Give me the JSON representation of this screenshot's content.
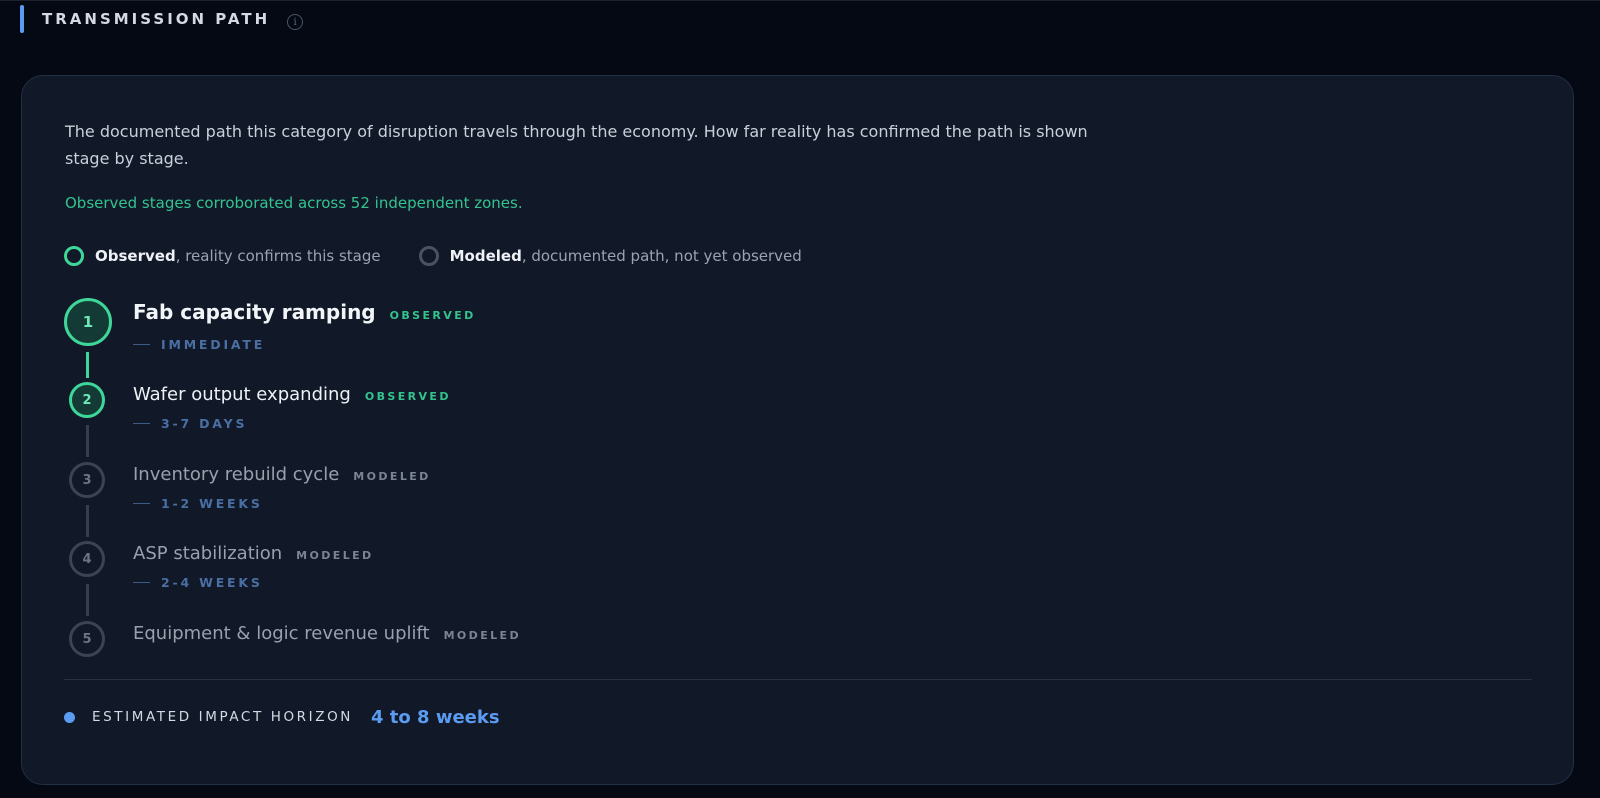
{
  "header": {
    "title": "TRANSMISSION PATH",
    "info_glyph": "i"
  },
  "card": {
    "description": "The documented path this category of disruption travels through the economy. How far reality has confirmed the path is shown stage by stage.",
    "corroboration": "Observed stages corroborated across 52 independent zones.",
    "legend": {
      "observed": {
        "label": "Observed",
        "desc": ", reality confirms this stage"
      },
      "modeled": {
        "label": "Modeled",
        "desc": ", documented path, not yet observed"
      }
    },
    "stages": [
      {
        "number": "1",
        "name": "Fab capacity ramping",
        "status": "OBSERVED",
        "timing": "IMMEDIATE"
      },
      {
        "number": "2",
        "name": "Wafer output expanding",
        "status": "OBSERVED",
        "timing": "3-7 DAYS"
      },
      {
        "number": "3",
        "name": "Inventory rebuild cycle",
        "status": "MODELED",
        "timing": "1-2 WEEKS"
      },
      {
        "number": "4",
        "name": "ASP stabilization",
        "status": "MODELED",
        "timing": "2-4 WEEKS"
      },
      {
        "number": "5",
        "name": "Equipment & logic revenue uplift",
        "status": "MODELED",
        "timing": ""
      }
    ],
    "horizon": {
      "label": "ESTIMATED IMPACT HORIZON",
      "value": "4 to 8 weeks"
    }
  },
  "colors": {
    "observed": "#3fd69a",
    "modeled": "#4a5362",
    "accent": "#5b9cf2",
    "background": "#040914",
    "card": "#111827"
  }
}
